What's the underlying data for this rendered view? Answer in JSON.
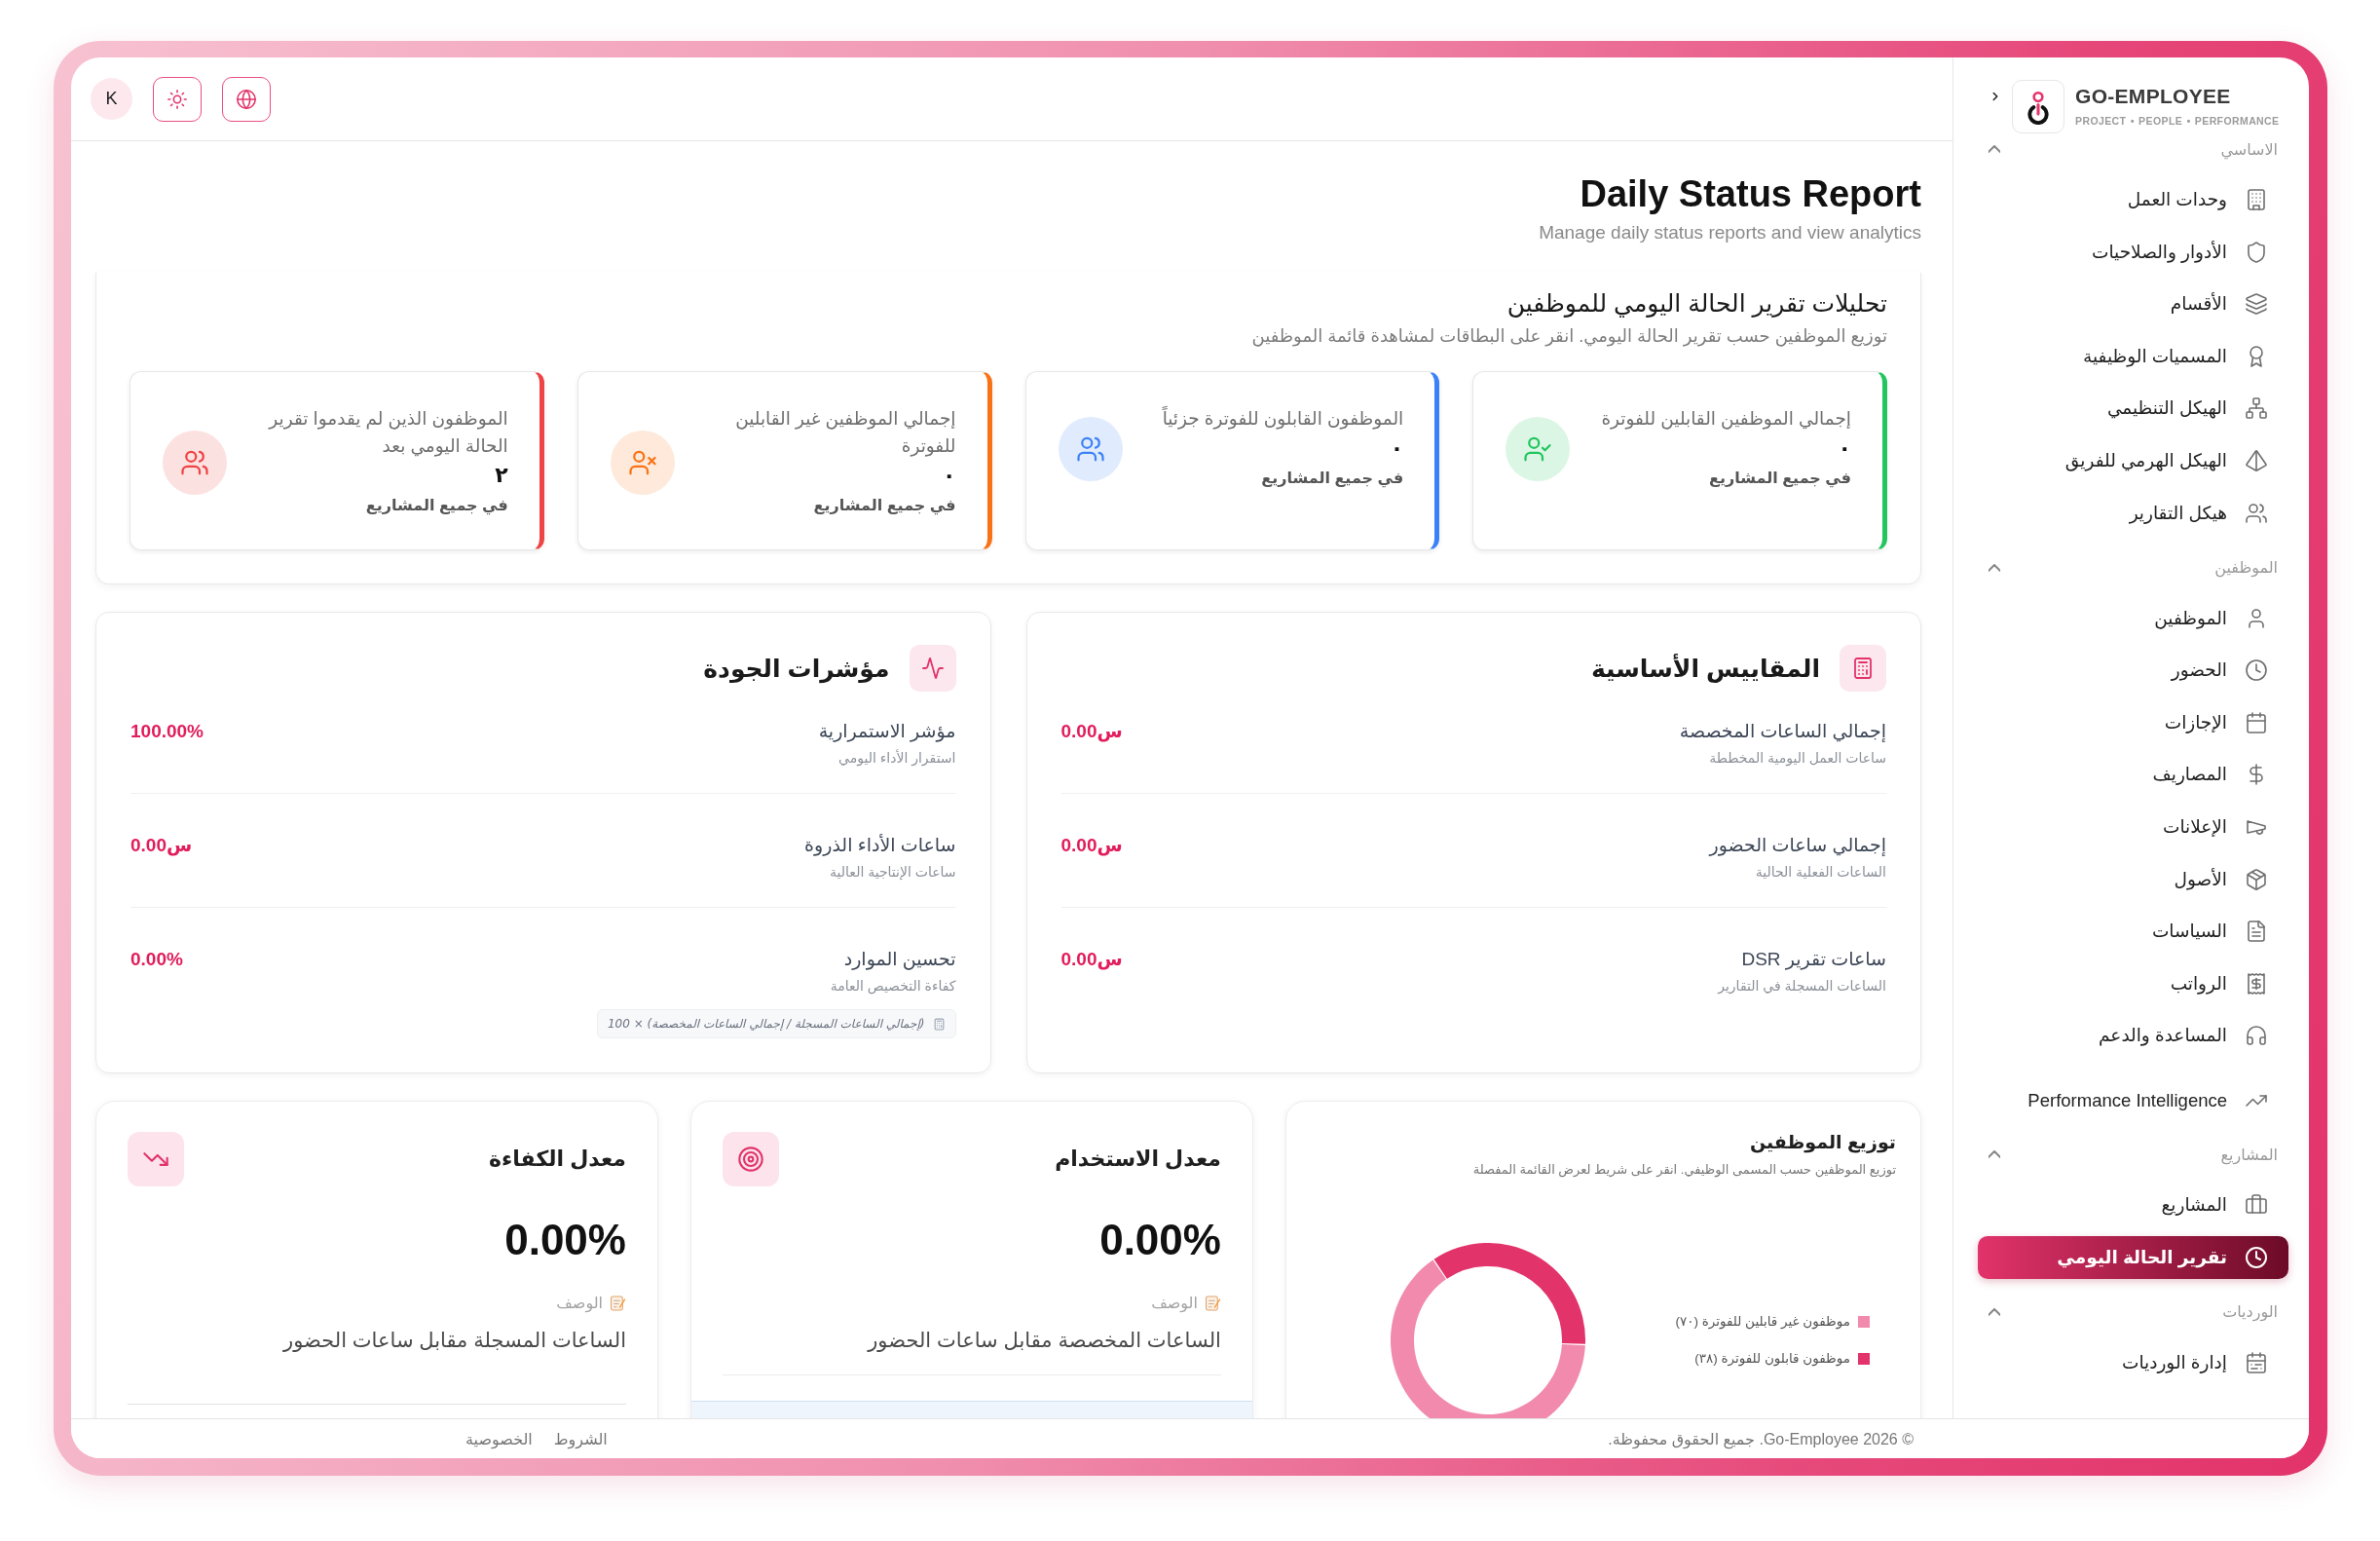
{
  "topbar": {
    "avatar": "K"
  },
  "sidebar": {
    "brand": "GO-EMPLOYEE",
    "tagline": "PROJECT *•* PEOPLE *•* PERFORMANCE",
    "nav": [
      {
        "kind": "section",
        "title": "الاساسي",
        "expanded": true,
        "items": [
          {
            "label": "وحدات العمل",
            "selected": false
          },
          {
            "label": "الأدوار والصلاحيات",
            "selected": false
          },
          {
            "label": "الأقسام",
            "selected": false
          },
          {
            "label": "المسميات الوظيفية",
            "selected": false
          },
          {
            "label": "الهيكل التنظيمي",
            "selected": false
          },
          {
            "label": "الهيكل الهرمي للفريق",
            "selected": false
          },
          {
            "label": "هيكل التقارير",
            "selected": false
          }
        ]
      },
      {
        "kind": "section",
        "title": "الموظفين",
        "expanded": true,
        "items": [
          {
            "label": "الموظفين",
            "selected": false
          },
          {
            "label": "الحضور",
            "selected": false
          },
          {
            "label": "الإجازات",
            "selected": false
          },
          {
            "label": "المصاريف",
            "selected": false
          },
          {
            "label": "الإعلانات",
            "selected": false
          },
          {
            "label": "الأصول",
            "selected": false
          },
          {
            "label": "السياسات",
            "selected": false
          },
          {
            "label": "الرواتب",
            "selected": false
          },
          {
            "label": "المساعدة والدعم",
            "selected": false
          }
        ]
      },
      {
        "kind": "link",
        "label": "Performance Intelligence",
        "selected": false
      },
      {
        "kind": "section",
        "title": "المشاريع",
        "expanded": true,
        "items": [
          {
            "label": "المشاريع",
            "selected": false
          },
          {
            "label": "تقرير الحالة اليومي",
            "selected": true
          }
        ]
      },
      {
        "kind": "section",
        "title": "الورديات",
        "expanded": true,
        "items": [
          {
            "label": "إدارة الورديات",
            "selected": false
          }
        ]
      }
    ]
  },
  "page": {
    "title": "Daily Status Report",
    "subtitle": "Manage daily status reports and view analytics"
  },
  "analytics": {
    "title": "تحليلات تقرير الحالة اليومي للموظفين",
    "subtitle": "توزيع الموظفين حسب تقرير الحالة اليومي. انقر على البطاقات لمشاهدة قائمة الموظفين",
    "cards": [
      {
        "label": "إجمالي الموظفين القابلين للفوترة",
        "value": "٠",
        "scope": "في جميع المشاريع",
        "color": "#22c55e"
      },
      {
        "label": "الموظفون القابلون للفوترة جزئياً",
        "value": "٠",
        "scope": "في جميع المشاريع",
        "color": "#3b82f6"
      },
      {
        "label": "إجمالي الموظفين غير القابلين للفوترة",
        "value": "٠",
        "scope": "في جميع المشاريع",
        "color": "#f97316"
      },
      {
        "label": "الموظفون الذين لم يقدموا تقرير الحالة اليومي بعد",
        "value": "٢",
        "scope": "في جميع المشاريع",
        "color": "#ef4444"
      }
    ]
  },
  "metric_panels": [
    {
      "title": "المقاييس الأساسية",
      "rows": [
        {
          "label": "إجمالي الساعات المخصصة",
          "description": "ساعات العمل اليومية المخططة",
          "value": "0.00س"
        },
        {
          "label": "إجمالي ساعات الحضور",
          "description": "الساعات الفعلية الحالية",
          "value": "0.00س"
        },
        {
          "label": "ساعات تقرير DSR",
          "description": "الساعات المسجلة في التقارير",
          "value": "0.00س"
        }
      ]
    },
    {
      "title": "مؤشرات الجودة",
      "rows": [
        {
          "label": "مؤشر الاستمرارية",
          "description": "استقرار الأداء اليومي",
          "value": "100.00%"
        },
        {
          "label": "ساعات الأداء الذروة",
          "description": "ساعات الإنتاجية العالية",
          "value": "0.00س"
        },
        {
          "label": "تحسين الموارد",
          "description": "كفاءة التخصيص العامة",
          "value": "0.00%"
        }
      ],
      "formula": "(إجمالي الساعات المسجلة / إجمالي الساعات المخصصة) × 100"
    }
  ],
  "distribution": {
    "title": "توزيع الموظفين",
    "subtitle": "توزيع الموظفين حسب المسمى الوظيفي. انقر على شريط لعرض القائمة المفصلة",
    "chart_data": {
      "type": "donut",
      "categories": [
        "موظفون غير قابلين للفوترة (٧٠)",
        "موظفون قابلون للفوترة (٣٨)"
      ],
      "values": [
        70,
        38
      ],
      "colors": [
        "#f18aac",
        "#e2336b"
      ],
      "legend": "right"
    }
  },
  "rate_cards": [
    {
      "title": "معدل الاستخدام",
      "value": "0.00%",
      "description_label": "الوصف",
      "description": "الساعات المخصصة مقابل ساعات الحضور",
      "highlighted": true
    },
    {
      "title": "معدل الكفاءة",
      "value": "0.00%",
      "description_label": "الوصف",
      "description": "الساعات المسجلة مقابل ساعات الحضور",
      "highlighted": false
    }
  ],
  "footer": {
    "copyright": "© 2026 Go-Employee. جميع الحقوق محفوظة.",
    "links": [
      "الشروط",
      "الخصوصية"
    ]
  }
}
